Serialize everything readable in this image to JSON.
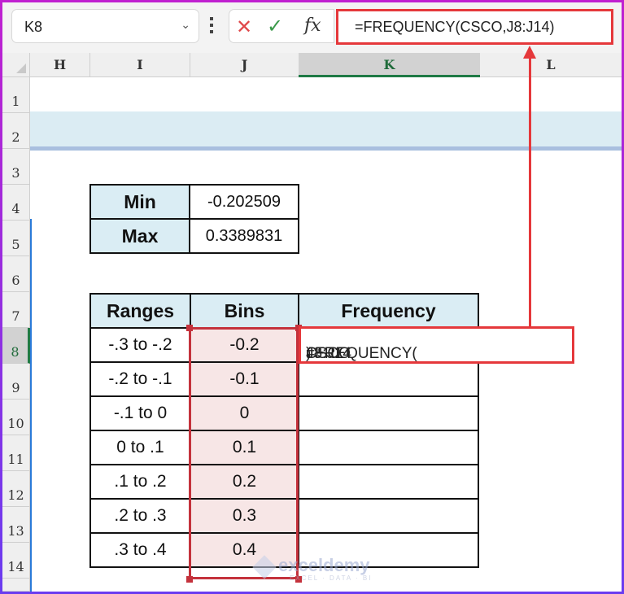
{
  "name_box": {
    "value": "K8",
    "dropdown_icon": "chevron-down-icon"
  },
  "formula_bar": {
    "cancel_icon": "x-icon",
    "enter_icon": "checkmark-icon",
    "fx_label": "fx",
    "formula": "=FREQUENCY(CSCO,J8:J14)"
  },
  "columns": [
    "H",
    "I",
    "J",
    "K",
    "L"
  ],
  "selected_column": "K",
  "rows": [
    "1",
    "2",
    "3",
    "4",
    "5",
    "6",
    "7",
    "8",
    "9",
    "10",
    "11",
    "12",
    "13",
    "14"
  ],
  "selected_row": "8",
  "min_max_table": {
    "rows": [
      {
        "label": "Min",
        "value": "-0.202509"
      },
      {
        "label": "Max",
        "value": "0.3389831"
      }
    ]
  },
  "frequency_table": {
    "headers": [
      "Ranges",
      "Bins",
      "Frequency"
    ],
    "rows": [
      {
        "range": "-.3 to -.2",
        "bin": "-0.2",
        "frequency": ""
      },
      {
        "range": "-.2 to -.1",
        "bin": "-0.1",
        "frequency": ""
      },
      {
        "range": "-.1 to 0",
        "bin": "0",
        "frequency": ""
      },
      {
        "range": "0 to .1",
        "bin": "0.1",
        "frequency": ""
      },
      {
        "range": ".1 to .2",
        "bin": "0.2",
        "frequency": ""
      },
      {
        "range": ".2 to .3",
        "bin": "0.3",
        "frequency": ""
      },
      {
        "range": ".3 to .4",
        "bin": "0.4",
        "frequency": ""
      }
    ]
  },
  "cell_edit": {
    "prefix": "=FREQUENCY(",
    "arg1": "CSCO",
    "sep": ",",
    "arg2": "J8:J14",
    "suffix": ")"
  },
  "watermark": {
    "name": "exceldemy",
    "tagline": "EXCEL · DATA · BI"
  },
  "colors": {
    "accent_red": "#e5383b",
    "header_fill": "#daedf4",
    "bin_fill": "#f7e6e6",
    "ref_blue": "#2a7fd4",
    "ref_red": "#c8323c"
  }
}
